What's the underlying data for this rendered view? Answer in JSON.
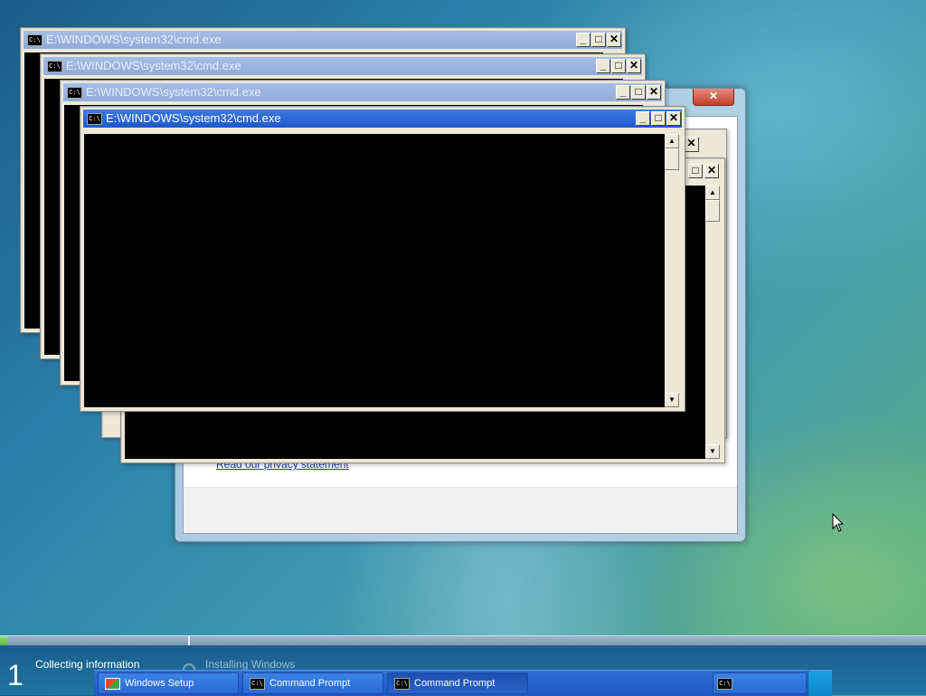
{
  "setup_dialog": {
    "close_glyph": "✕",
    "privacy_link": "Read our privacy statement"
  },
  "cmd_windows": [
    {
      "title": "E:\\WINDOWS\\system32\\cmd.exe",
      "state": "inactive"
    },
    {
      "title": "E:\\WINDOWS\\system32\\cmd.exe",
      "state": "inactive"
    },
    {
      "title": "E:\\WINDOWS\\system32\\cmd.exe",
      "state": "inactive"
    },
    {
      "title": "E:\\WINDOWS\\system32\\cmd.exe",
      "state": "active"
    }
  ],
  "cmd_icon_text": "C:\\",
  "window_buttons": {
    "minimize": "_",
    "maximize": "□",
    "close": "✕"
  },
  "scroll_arrows": {
    "up": "▲",
    "down": "▼"
  },
  "setup_progress": {
    "step_number": "1",
    "step1_label": "Collecting information",
    "step2_label": "Installing Windows",
    "fill_fraction": 0.008
  },
  "taskbar": {
    "items": [
      {
        "label": "Windows Setup",
        "icon": "windows-setup-icon"
      },
      {
        "label": "Command Prompt",
        "icon": "cmd-icon"
      },
      {
        "label": "Command Prompt",
        "icon": "cmd-icon"
      },
      {
        "label": "",
        "icon": "cmd-icon"
      }
    ]
  },
  "colors": {
    "active_title": "#1d58c9",
    "inactive_title": "#93abd9",
    "console_bg": "#000000",
    "progress_fill": "#5fb64b"
  }
}
